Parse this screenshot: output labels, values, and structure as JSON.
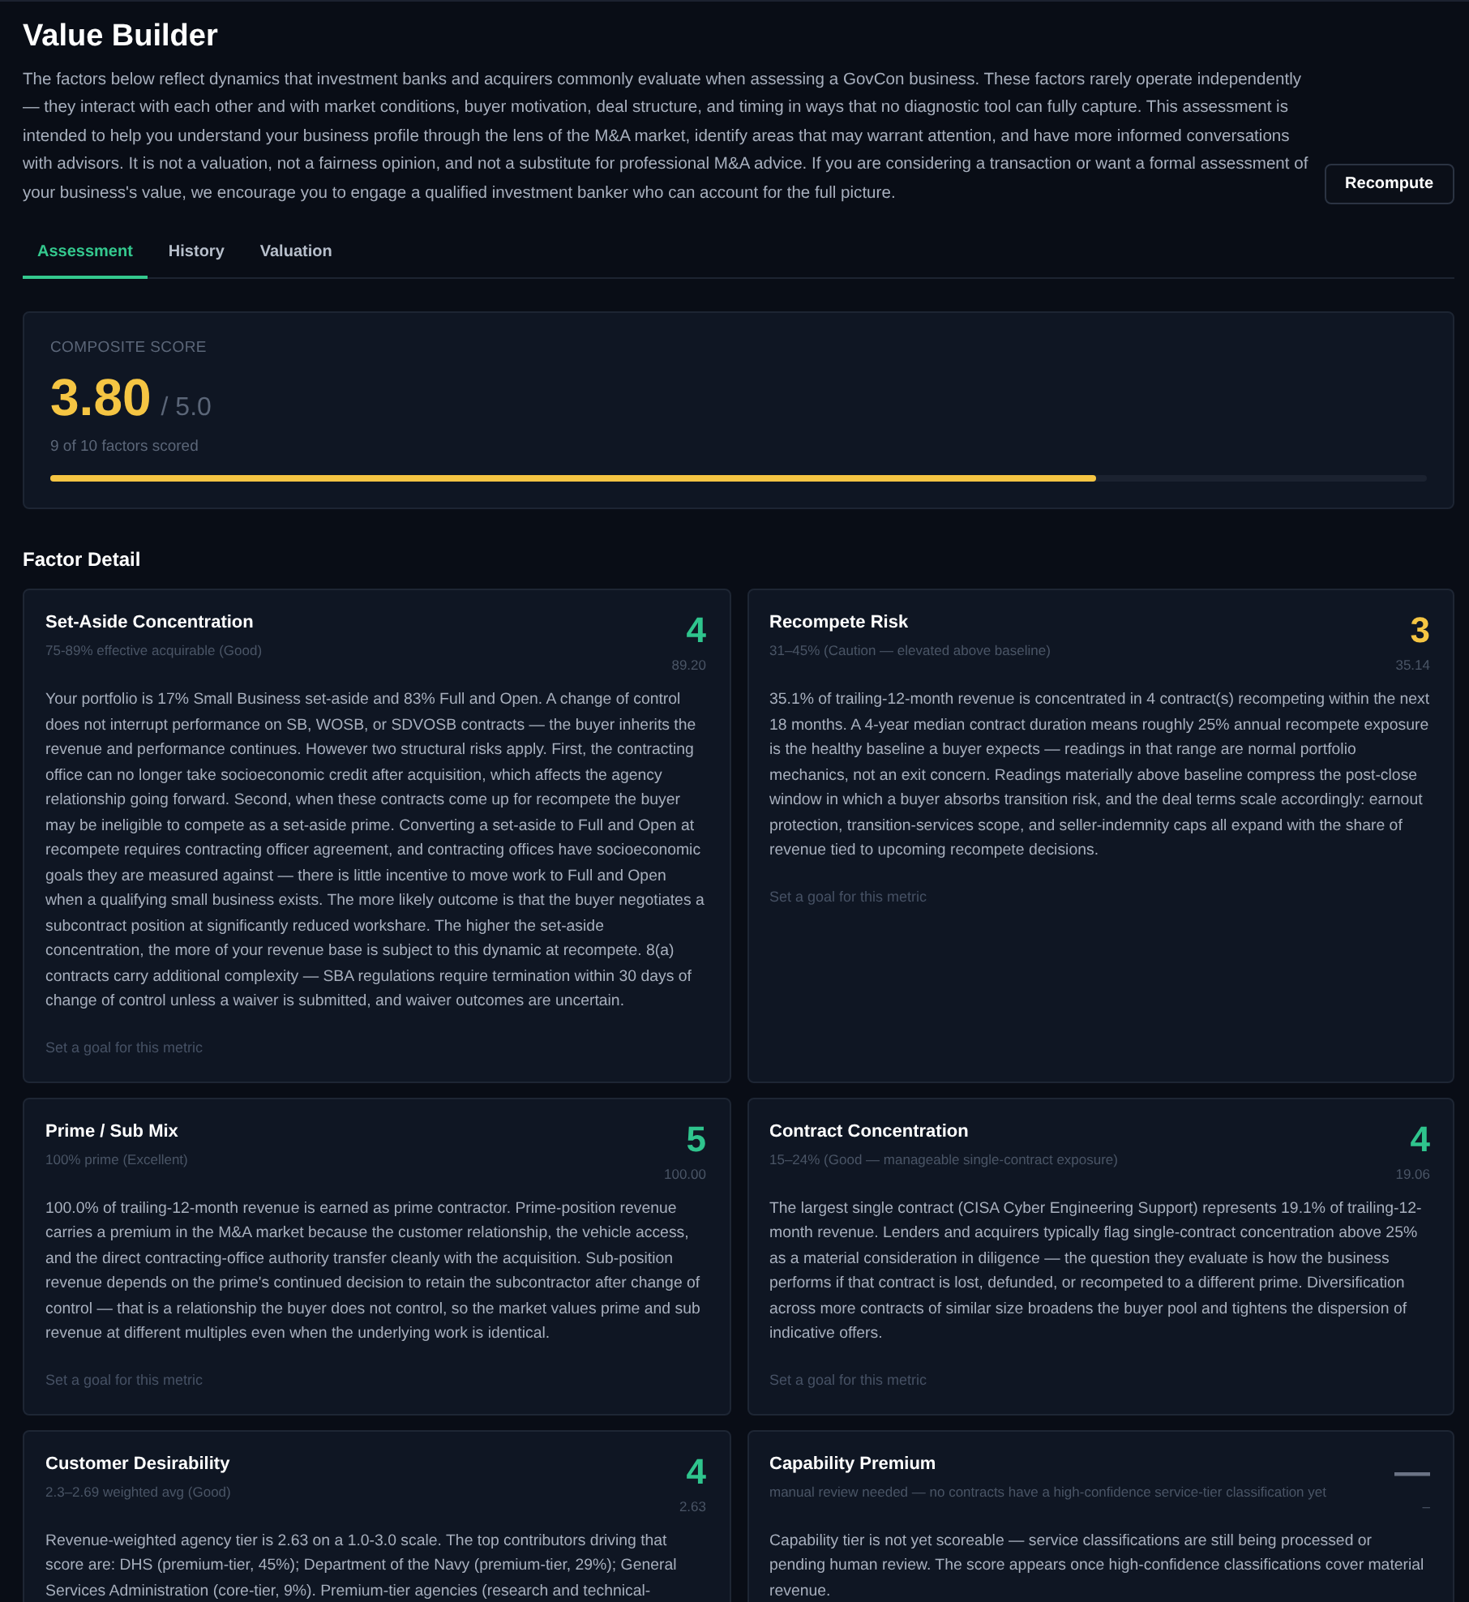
{
  "page": {
    "title": "Value Builder",
    "description": "The factors below reflect dynamics that investment banks and acquirers commonly evaluate when assessing a GovCon business. These factors rarely operate independently — they interact with each other and with market conditions, buyer motivation, deal structure, and timing in ways that no diagnostic tool can fully capture. This assessment is intended to help you understand your business profile through the lens of the M&A market, identify areas that may warrant attention, and have more informed conversations with advisors. It is not a valuation, not a fairness opinion, and not a substitute for professional M&A advice. If you are considering a transaction or want a formal assessment of your business's value, we encourage you to engage a qualified investment banker who can account for the full picture.",
    "recompute_button": "Recompute"
  },
  "tabs": [
    {
      "label": "Assessment",
      "selected": true
    },
    {
      "label": "History",
      "selected": false
    },
    {
      "label": "Valuation",
      "selected": false
    }
  ],
  "composite_score": {
    "label": "COMPOSITE SCORE",
    "score": "3.80",
    "max": "/ 5.0",
    "factors_scored": "9 of 10 factors scored",
    "level": 0.76
  },
  "factor_detail": {
    "heading": "Factor Detail",
    "factors": [
      {
        "name": "Set-Aside Concentration",
        "range": "75-89% effective acquirable (Good)",
        "score": "4",
        "color": "#2fc48d",
        "value": "89.20",
        "description": "Your portfolio is 17% Small Business set-aside and 83% Full and Open. A change of control does not interrupt performance on SB, WOSB, or SDVOSB contracts — the buyer inherits the revenue and performance continues. However two structural risks apply. First, the contracting office can no longer take socioeconomic credit after acquisition, which affects the agency relationship going forward. Second, when these contracts come up for recompete the buyer may be ineligible to compete as a set-aside prime. Converting a set-aside to Full and Open at recompete requires contracting officer agreement, and contracting offices have socioeconomic goals they are measured against — there is little incentive to move work to Full and Open when a qualifying small business exists. The more likely outcome is that the buyer negotiates a subcontract position at significantly reduced workshare. The higher the set-aside concentration, the more of your revenue base is subject to this dynamic at recompete. 8(a) contracts carry additional complexity — SBA regulations require termination within 30 days of change of control unless a waiver is submitted, and waiver outcomes are uncertain.",
        "goal_link": "Set a goal for this metric"
      },
      {
        "name": "Recompete Risk",
        "range": "31–45% (Caution — elevated above baseline)",
        "score": "3",
        "color": "#f5c543",
        "value": "35.14",
        "description": "35.1% of trailing-12-month revenue is concentrated in 4 contract(s) recompeting within the next 18 months. A 4-year median contract duration means roughly 25% annual recompete exposure is the healthy baseline a buyer expects — readings in that range are normal portfolio mechanics, not an exit concern. Readings materially above baseline compress the post-close window in which a buyer absorbs transition risk, and the deal terms scale accordingly: earnout protection, transition-services scope, and seller-indemnity caps all expand with the share of revenue tied to upcoming recompete decisions.",
        "goal_link": "Set a goal for this metric"
      },
      {
        "name": "Prime / Sub Mix",
        "range": "100% prime (Excellent)",
        "score": "5",
        "color": "#2fc48d",
        "value": "100.00",
        "description": "100.0% of trailing-12-month revenue is earned as prime contractor. Prime-position revenue carries a premium in the M&A market because the customer relationship, the vehicle access, and the direct contracting-office authority transfer cleanly with the acquisition. Sub-position revenue depends on the prime's continued decision to retain the subcontractor after change of control — that is a relationship the buyer does not control, so the market values prime and sub revenue at different multiples even when the underlying work is identical.",
        "goal_link": "Set a goal for this metric"
      },
      {
        "name": "Contract Concentration",
        "range": "15–24% (Good — manageable single-contract exposure)",
        "score": "4",
        "color": "#2fc48d",
        "value": "19.06",
        "description": "The largest single contract (CISA Cyber Engineering Support) represents 19.1% of trailing-12-month revenue. Lenders and acquirers typically flag single-contract concentration above 25% as a material consideration in diligence — the question they evaluate is how the business performs if that contract is lost, defunded, or recompeted to a different prime. Diversification across more contracts of similar size broadens the buyer pool and tightens the dispersion of indicative offers.",
        "goal_link": "Set a goal for this metric"
      },
      {
        "name": "Customer Desirability",
        "range": "2.3–2.69 weighted avg (Good)",
        "score": "4",
        "color": "#2fc48d",
        "value": "2.63",
        "description": "Revenue-weighted agency tier is 2.63 on a 1.0-3.0 scale. The top contributors driving that score are: DHS (premium-tier, 45%); Department of the Navy (premium-tier, 29%); General Services Administration (core-tier, 9%). Premium-tier agencies (research and technical-"
      },
      {
        "name": "Capability Premium",
        "range": "manual review needed — no contracts have a high-confidence service-tier classification yet",
        "score": "—",
        "color": "#6b7385",
        "value": "–",
        "description": "Capability tier is not yet scoreable — service classifications are still being processed or pending human review. The score appears once high-confidence classifications cover material revenue."
      }
    ]
  }
}
